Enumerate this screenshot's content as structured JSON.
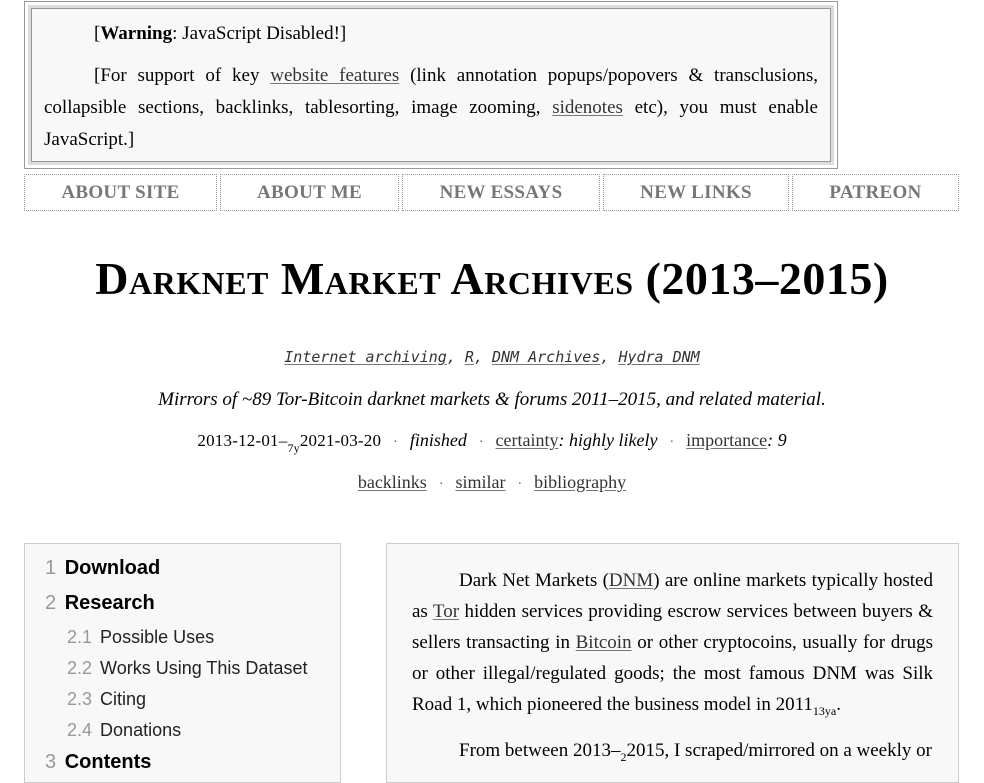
{
  "warning": {
    "label": "Warning",
    "rest": ": JavaScript Disabled!]",
    "open_bracket": "[",
    "support_pre": "[For support of key ",
    "website_features": "website features",
    "support_mid": " (link annotation popups/popovers & transclusions, collapsible sections, backlinks, tablesorting, image zooming, ",
    "sidenotes": "sidenotes",
    "support_post": " etc), you must enable JavaScript.]"
  },
  "nav": {
    "items": [
      "ABOUT SITE",
      "ABOUT ME",
      "NEW ESSAYS",
      "NEW LINKS",
      "PATREON"
    ]
  },
  "title": "Darknet Market Archives (2013–2015)",
  "tags": {
    "items": [
      "Internet archiving",
      "R",
      "DNM Archives",
      "Hydra DNM"
    ],
    "separator": ","
  },
  "description": "Mirrors of ~89 Tor-Bitcoin darknet markets & forums 2011–2015, and related material.",
  "meta": {
    "date_start": "2013-12-01",
    "dash": "–",
    "date_span": "7y",
    "date_end": "2021-03-20",
    "status": "finished",
    "certainty_label": "certainty",
    "certainty_value": ": highly likely",
    "importance_label": "importance",
    "importance_value": ": 9",
    "dot": "·"
  },
  "links": [
    "backlinks",
    "similar",
    "bibliography"
  ],
  "toc": [
    {
      "num": "1",
      "label": "Download",
      "level": 1
    },
    {
      "num": "2",
      "label": "Research",
      "level": 1
    },
    {
      "num": "2.1",
      "label": "Possible Uses",
      "level": 2
    },
    {
      "num": "2.2",
      "label": "Works Using This Dataset",
      "level": 2
    },
    {
      "num": "2.3",
      "label": "Citing",
      "level": 2
    },
    {
      "num": "2.4",
      "label": "Donations",
      "level": 2
    },
    {
      "num": "3",
      "label": "Contents",
      "level": 1
    }
  ],
  "abstract": {
    "p1_pre": "Dark Net Markets (",
    "dnm": "DNM",
    "p1_a": ") are online markets typically hosted as ",
    "tor": "Tor",
    "p1_b": " hidden services providing escrow services between buyers & sellers transacting in ",
    "bitcoin": "Bitcoin",
    "p1_c": " or other cryptocoins, usually for drugs or other illegal/regulated goods; the most famous DNM was Silk Road 1, which pioneered the business model in 2011",
    "p1_sub": "13ya",
    "p1_end": ".",
    "p2_pre": "From between 2013",
    "p2_dash": "–",
    "p2_sub": "2",
    "p2_post": "2015, I scraped/mirrored on a weekly or"
  }
}
